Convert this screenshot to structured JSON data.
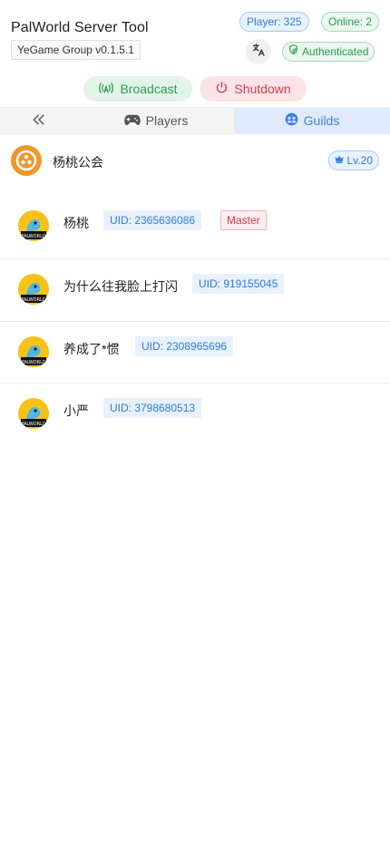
{
  "app": {
    "title": "PalWorld Server Tool",
    "version": "YeGame Group v0.1.5.1"
  },
  "status": {
    "player_count": "Player: 325",
    "online_count": "Online: 2",
    "auth": "Authenticated"
  },
  "actions": {
    "broadcast": "Broadcast",
    "shutdown": "Shutdown"
  },
  "tabs": {
    "players": "Players",
    "guilds": "Guilds",
    "active": "guilds"
  },
  "guild": {
    "name": "杨桃公会",
    "level": "Lv.20"
  },
  "members": [
    {
      "name": "杨桃",
      "uid": "UID: 2365636086",
      "role": "Master"
    },
    {
      "name": "为什么往我脸上打闪",
      "uid": "UID: 919155045"
    },
    {
      "name": "养成了*惯",
      "uid": "UID: 2308965696"
    },
    {
      "name": "小严",
      "uid": "UID: 3798680513"
    }
  ],
  "avatar_logo_text": "PALWORLD",
  "colors": {
    "primary": "#2f7be0",
    "success": "#2e9a52",
    "danger": "#d23b4f",
    "guild_logo": "#f0962a"
  }
}
